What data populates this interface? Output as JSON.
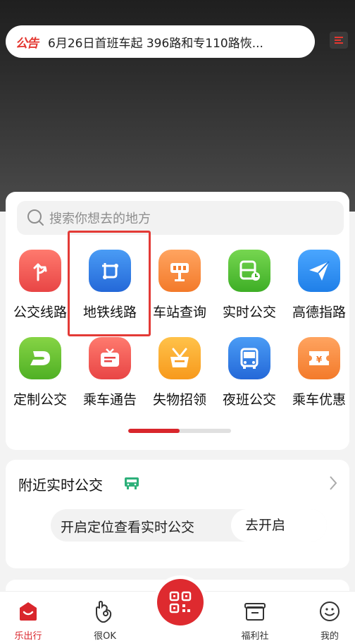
{
  "notice": {
    "tag": "公告",
    "text": "6月26日首班车起 396路和专110路恢..."
  },
  "search": {
    "placeholder": "搜索你想去的地方"
  },
  "grid": [
    {
      "label": "公交线路",
      "icon": "bus-route-icon",
      "color": "#ef5450"
    },
    {
      "label": "地铁线路",
      "icon": "subway-route-icon",
      "color": "#2f7fe6"
    },
    {
      "label": "车站查询",
      "icon": "station-query-icon",
      "color": "#ff8a3c"
    },
    {
      "label": "实时公交",
      "icon": "realtime-bus-icon",
      "color": "#52c234"
    },
    {
      "label": "高德指路",
      "icon": "amap-navigation-icon",
      "color": "#2b8ef0"
    },
    {
      "label": "定制公交",
      "icon": "custom-bus-icon",
      "color": "#67c02a"
    },
    {
      "label": "乘车通告",
      "icon": "ride-notice-icon",
      "color": "#ef5450"
    },
    {
      "label": "失物招领",
      "icon": "lost-found-icon",
      "color": "#ffa92b"
    },
    {
      "label": "夜班公交",
      "icon": "night-bus-icon",
      "color": "#2f7fe6"
    },
    {
      "label": "乘车优惠",
      "icon": "ride-discount-icon",
      "color": "#ff8a3c"
    }
  ],
  "pager": {
    "progress": 0.5
  },
  "nearby": {
    "title": "附近实时公交",
    "message": "开启定位查看实时公交",
    "action": "去开启"
  },
  "tabs": [
    {
      "label": "乐出行",
      "icon": "home-icon",
      "active": true
    },
    {
      "label": "很OK",
      "icon": "ok-hand-icon",
      "active": false
    },
    {
      "label": "福利社",
      "icon": "gift-box-icon",
      "active": false
    },
    {
      "label": "我的",
      "icon": "profile-icon",
      "active": false
    }
  ],
  "colors": {
    "accent": "#d9262c",
    "highlight": "#e33a36"
  }
}
